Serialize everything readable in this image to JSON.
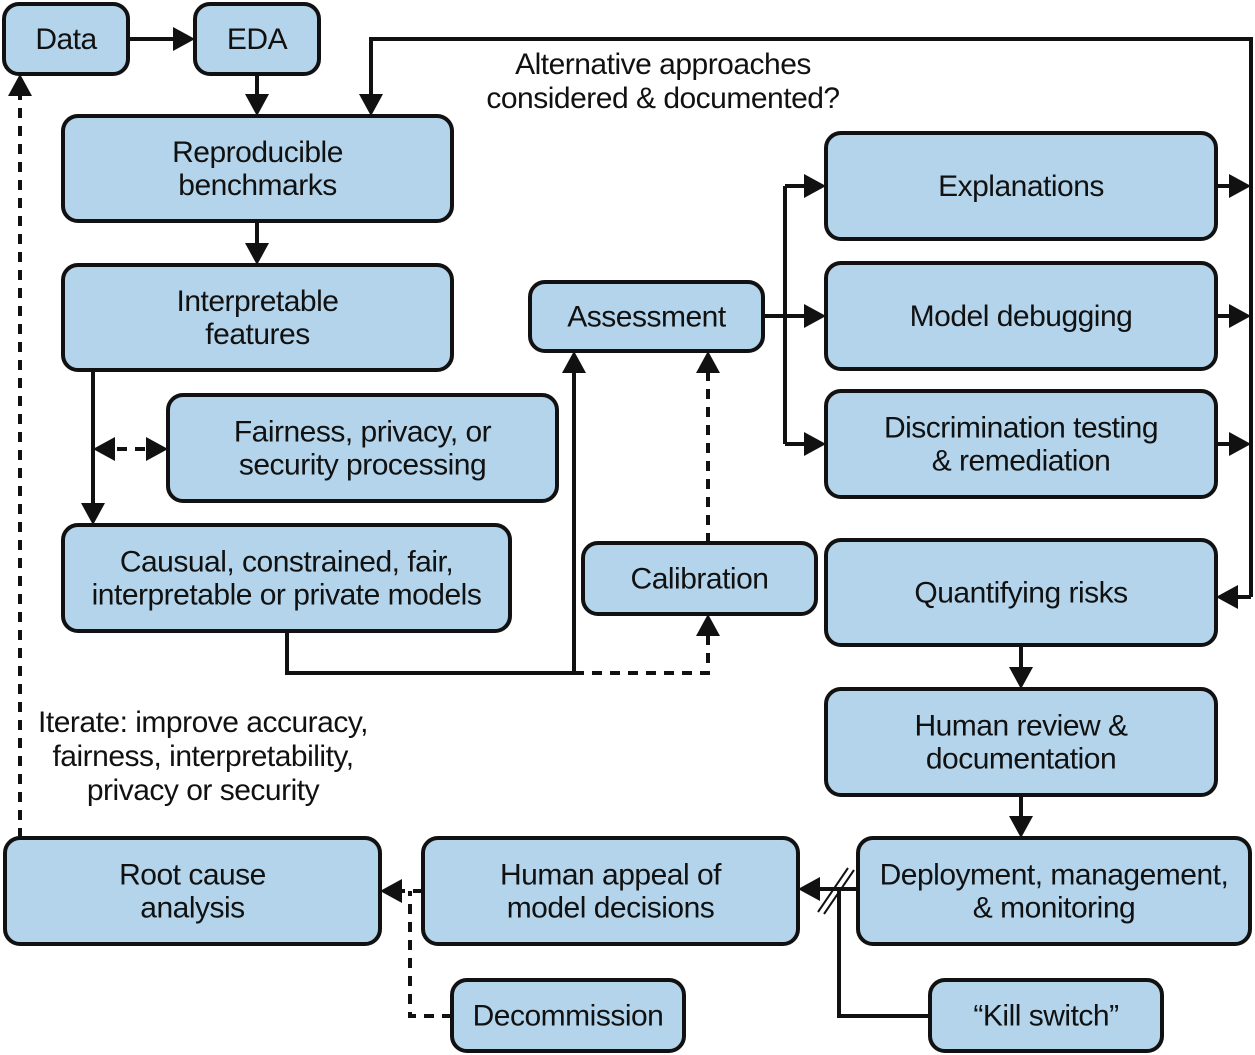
{
  "diagram": {
    "colors": {
      "box_fill": "#b3d4ea",
      "stroke": "#111111",
      "background": "#ffffff"
    },
    "nodes": {
      "data": [
        "Data"
      ],
      "eda": [
        "EDA"
      ],
      "benchmarks": [
        "Reproducible",
        "benchmarks"
      ],
      "features": [
        "Interpretable",
        "features"
      ],
      "processing": [
        "Fairness, privacy, or",
        "security processing"
      ],
      "models": [
        "Causual, constrained, fair,",
        "interpretable or private models"
      ],
      "assessment": [
        "Assessment"
      ],
      "calibration": [
        "Calibration"
      ],
      "explanations": [
        "Explanations"
      ],
      "debugging": [
        "Model debugging"
      ],
      "discrimination": [
        "Discrimination testing",
        "& remediation"
      ],
      "risks": [
        "Quantifying risks"
      ],
      "review": [
        "Human review &",
        "documentation"
      ],
      "deployment": [
        "Deployment, management,",
        "& monitoring"
      ],
      "killswitch": [
        "“Kill switch”"
      ],
      "appeal": [
        "Human appeal of",
        "model decisions"
      ],
      "rootcause": [
        "Root cause",
        "analysis"
      ],
      "decommission": [
        "Decommission"
      ]
    },
    "annotations": {
      "alternatives": [
        "Alternative approaches",
        "considered & documented?"
      ],
      "iterate": [
        "Iterate: improve accuracy,",
        "fairness, interpretability,",
        "privacy or security"
      ]
    },
    "edges": [
      {
        "from": "data",
        "to": "eda",
        "style": "solid"
      },
      {
        "from": "eda",
        "to": "benchmarks",
        "style": "solid"
      },
      {
        "from": "benchmarks",
        "to": "features",
        "style": "solid"
      },
      {
        "from": "features",
        "to": "models",
        "style": "solid"
      },
      {
        "from": "features",
        "to": "processing",
        "style": "dashed",
        "bidirectional": true
      },
      {
        "from": "models",
        "to": "assessment",
        "style": "solid"
      },
      {
        "from": "models",
        "to": "calibration",
        "style": "dashed"
      },
      {
        "from": "calibration",
        "to": "assessment",
        "style": "dashed"
      },
      {
        "from": "assessment",
        "to": "explanations",
        "style": "solid"
      },
      {
        "from": "assessment",
        "to": "debugging",
        "style": "solid"
      },
      {
        "from": "assessment",
        "to": "discrimination",
        "style": "solid"
      },
      {
        "from": "explanations",
        "to": "risks",
        "style": "solid"
      },
      {
        "from": "debugging",
        "to": "risks",
        "style": "solid"
      },
      {
        "from": "discrimination",
        "to": "risks",
        "style": "solid"
      },
      {
        "from": "risks",
        "to": "benchmarks",
        "style": "solid",
        "label": "alternatives"
      },
      {
        "from": "risks",
        "to": "review",
        "style": "solid"
      },
      {
        "from": "review",
        "to": "deployment",
        "style": "solid"
      },
      {
        "from": "deployment",
        "to": "appeal",
        "style": "solid",
        "interrupted_by": "killswitch"
      },
      {
        "from": "appeal",
        "to": "rootcause",
        "style": "dashed"
      },
      {
        "from": "decommission",
        "to": "rootcause",
        "style": "dashed"
      },
      {
        "from": "rootcause",
        "to": "data",
        "style": "dashed",
        "label": "iterate"
      }
    ]
  }
}
